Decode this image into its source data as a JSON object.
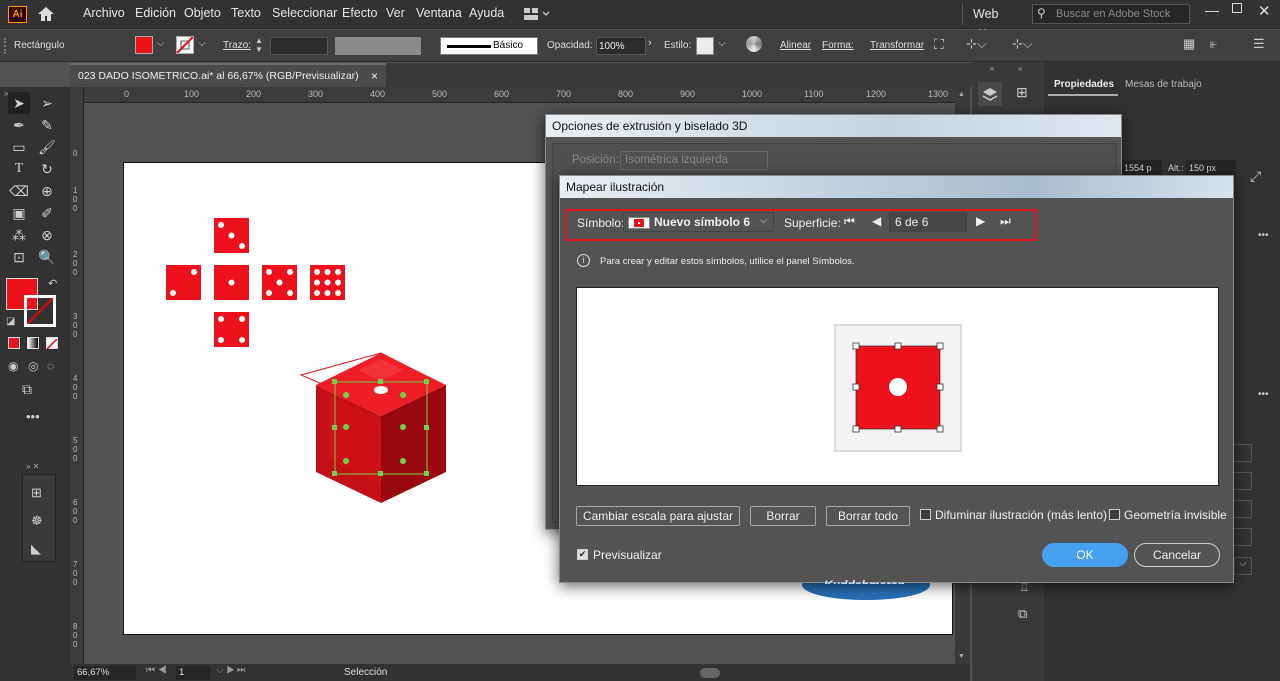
{
  "menu": {
    "app_logo": "Ai",
    "items": [
      "Archivo",
      "Edición",
      "Objeto",
      "Texto",
      "Seleccionar",
      "Efecto",
      "Ver",
      "Ventana",
      "Ayuda"
    ],
    "workspace": "Web",
    "search_placeholder": "Buscar en Adobe Stock"
  },
  "control": {
    "object_type": "Rectángulo",
    "stroke_label": "Trazo:",
    "brush_label": "Básico",
    "opacity_label": "Opacidad:",
    "opacity_value": "100%",
    "style_label": "Estilo:",
    "align_label": "Alinear",
    "shape_label": "Forma:",
    "transform_label": "Transformar"
  },
  "document": {
    "tab_title": "023 DADO ISOMETRICO.ai* al 66,67% (RGB/Previsualizar)",
    "close": "×"
  },
  "ruler": {
    "h_ticks": [
      "0",
      "100",
      "200",
      "300",
      "400",
      "500",
      "600",
      "700",
      "800",
      "900",
      "1000",
      "1100",
      "1200",
      "1300"
    ],
    "v_ticks": [
      "0",
      "1\n0\n0",
      "2\n0\n0",
      "3\n0\n0",
      "4\n0\n0",
      "5\n0\n0",
      "6\n0\n0",
      "7\n0\n0",
      "8\n0\n0"
    ]
  },
  "status": {
    "zoom": "66,67%",
    "artboard": "1",
    "tool": "Selección"
  },
  "properties": {
    "tab_props": "Propiedades",
    "tab_artboards": "Mesas de trabajo",
    "w_value": "1554 p",
    "h_label": "Alt.:",
    "h_value": "150 px"
  },
  "dialog_extrude": {
    "title": "Opciones de extrusión y biselado 3D",
    "position_label": "Posición:",
    "position_value": "Isométrica izquierda"
  },
  "dialog_map": {
    "title": "Mapear ilustración",
    "symbol_label": "Símbolo:",
    "symbol_value": "Nuevo símbolo 6",
    "surface_label": "Superficie:",
    "surface_value": "6 de 6",
    "info": "Para crear y editar estos símbolos, utilice el panel Símbolos.",
    "btn_scale": "Cambiar escala para ajustar",
    "btn_clear": "Borrar",
    "btn_clear_all": "Borrar todo",
    "chk_shade": "Difuminar ilustración (más lento)",
    "chk_invisible": "Geometría invisible",
    "chk_preview": "Previsualizar",
    "preview_checked": true,
    "btn_ok": "OK",
    "btn_cancel": "Cancelar"
  },
  "watermark": "Kuddshmeran",
  "colors": {
    "dice_red": "#ec111b",
    "highlight_red": "#e0141c",
    "ok_blue": "#46a0f0",
    "selection_green": "#6fd34a"
  }
}
